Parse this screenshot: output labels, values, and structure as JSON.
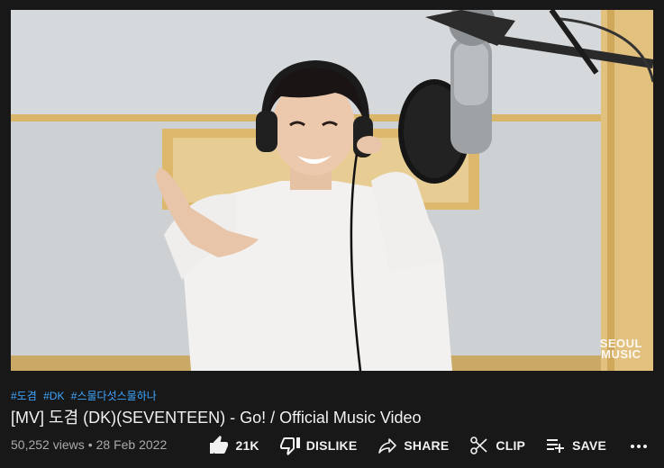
{
  "video": {
    "watermark_line1": "SEOUL",
    "watermark_line2": "MUSIC"
  },
  "hashtags": [
    "#도겸",
    "#DK",
    "#스물다섯스물하나"
  ],
  "title": "[MV] 도겸 (DK)(SEVENTEEN) - Go! / Official Music Video",
  "meta": {
    "views": "50,252 views",
    "separator": "•",
    "date": "28 Feb 2022"
  },
  "actions": {
    "like_count": "21K",
    "dislike_label": "DISLIKE",
    "share_label": "SHARE",
    "clip_label": "CLIP",
    "save_label": "SAVE"
  },
  "icons": {
    "like": "thumbs-up-icon",
    "dislike": "thumbs-down-icon",
    "share": "share-arrow-icon",
    "clip": "scissors-icon",
    "save": "playlist-add-icon",
    "more": "more-horizontal-icon"
  },
  "colors": {
    "background": "#181818",
    "text": "#f1f1f1",
    "secondary_text": "#aaaaaa",
    "hashtag": "#3ea6ff"
  }
}
